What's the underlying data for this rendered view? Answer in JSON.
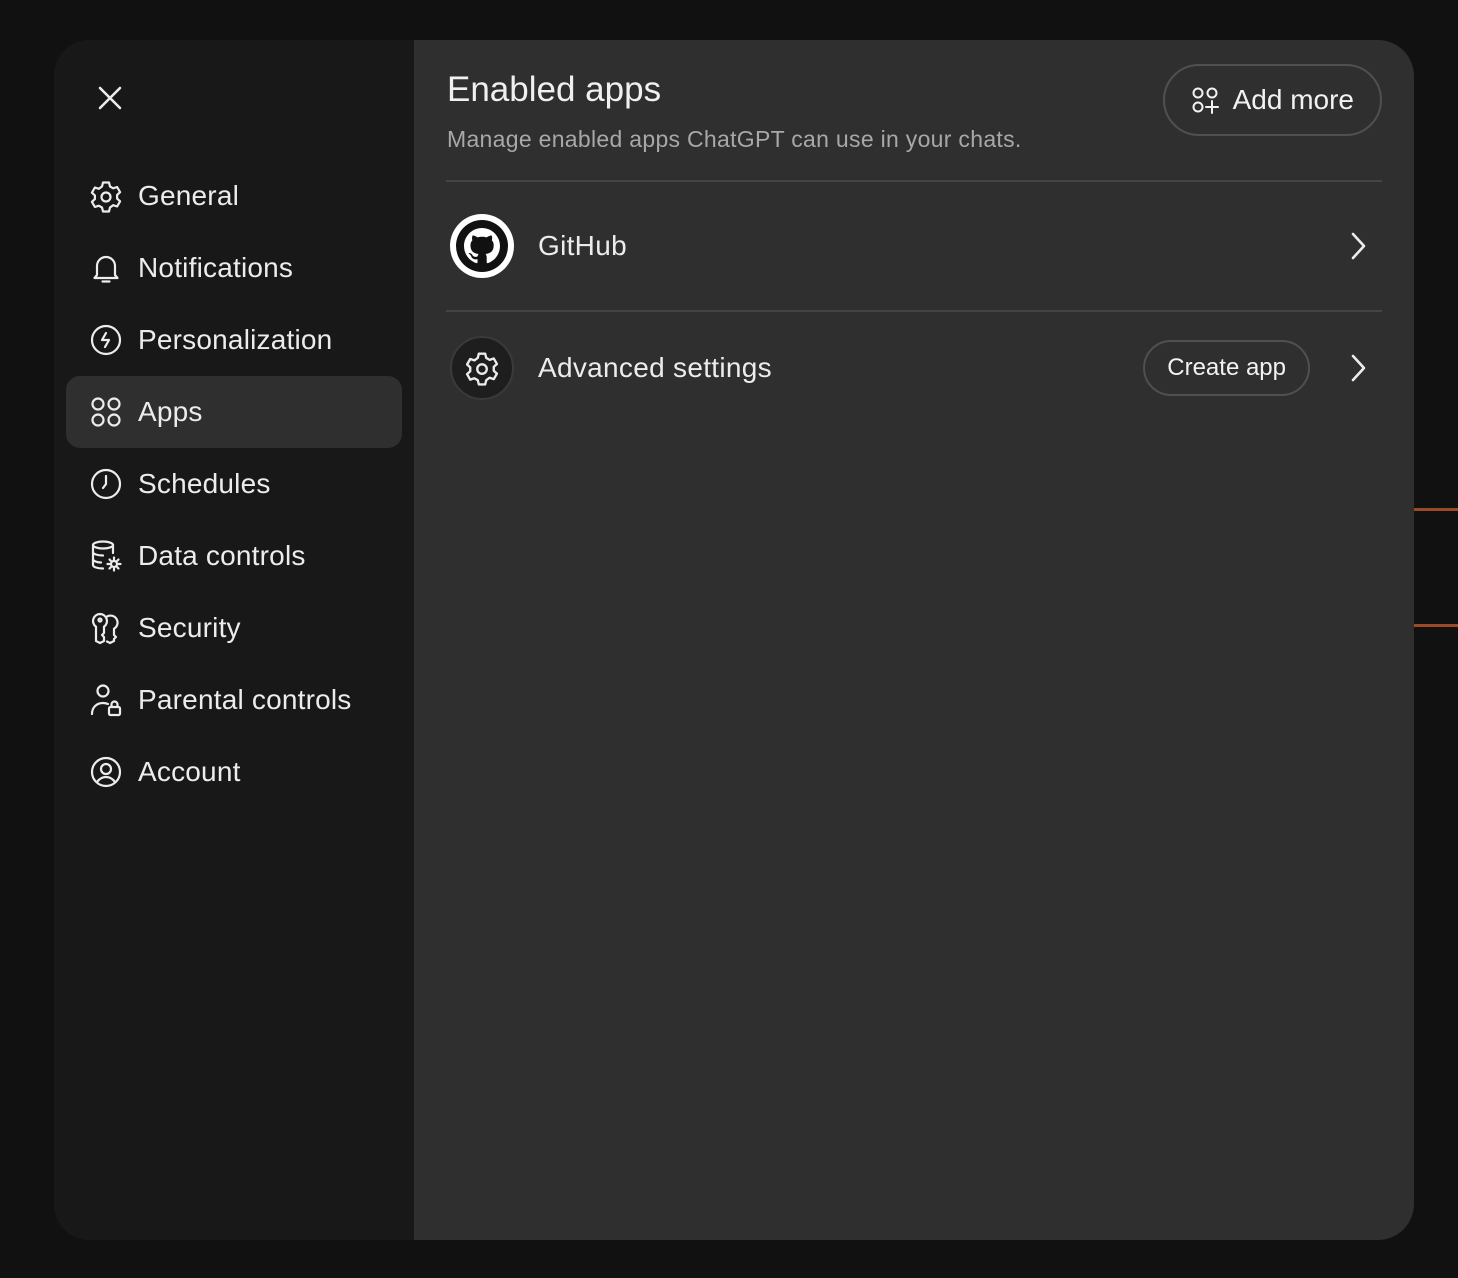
{
  "sidebar": {
    "close_icon": "close-icon",
    "items": [
      {
        "label": "General",
        "icon": "gear-icon",
        "active": false
      },
      {
        "label": "Notifications",
        "icon": "bell-icon",
        "active": false
      },
      {
        "label": "Personalization",
        "icon": "personalization-icon",
        "active": false
      },
      {
        "label": "Apps",
        "icon": "apps-grid-icon",
        "active": true
      },
      {
        "label": "Schedules",
        "icon": "clock-icon",
        "active": false
      },
      {
        "label": "Data controls",
        "icon": "database-gear-icon",
        "active": false
      },
      {
        "label": "Security",
        "icon": "keys-icon",
        "active": false
      },
      {
        "label": "Parental controls",
        "icon": "person-lock-icon",
        "active": false
      },
      {
        "label": "Account",
        "icon": "user-circle-icon",
        "active": false
      }
    ]
  },
  "main": {
    "title": "Enabled apps",
    "subtitle": "Manage enabled apps ChatGPT can use in your chats.",
    "add_more_label": "Add more",
    "apps": [
      {
        "label": "GitHub",
        "icon": "github-icon"
      }
    ],
    "advanced": {
      "label": "Advanced settings",
      "icon": "gear-icon",
      "create_app_label": "Create app"
    }
  },
  "colors": {
    "page_background": "#111111",
    "sidebar_background": "#181818",
    "main_background": "#2f2f2f",
    "active_item": "#2f2f2f",
    "text_primary": "#ececec",
    "text_secondary": "#a8a8a8",
    "accent_glow": "#b4532a"
  }
}
